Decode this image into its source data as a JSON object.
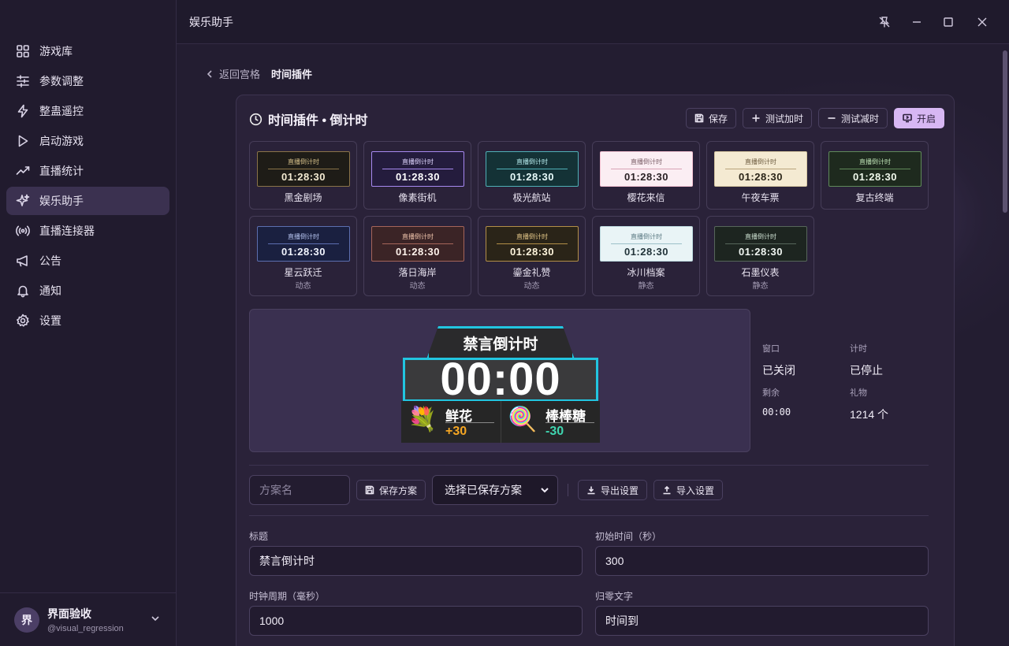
{
  "app": {
    "title": "娱乐助手"
  },
  "sidebar": {
    "items": [
      {
        "label": "游戏库",
        "icon": "grid-icon"
      },
      {
        "label": "参数调整",
        "icon": "sliders-icon"
      },
      {
        "label": "整蛊遥控",
        "icon": "lightning-icon"
      },
      {
        "label": "启动游戏",
        "icon": "play-icon"
      },
      {
        "label": "直播统计",
        "icon": "trend-icon"
      },
      {
        "label": "娱乐助手",
        "icon": "sparkle-icon",
        "active": true
      },
      {
        "label": "直播连接器",
        "icon": "broadcast-icon"
      },
      {
        "label": "公告",
        "icon": "megaphone-icon"
      },
      {
        "label": "通知",
        "icon": "bell-icon"
      },
      {
        "label": "设置",
        "icon": "gear-icon"
      }
    ],
    "user": {
      "avatar": "界",
      "name": "界面验收",
      "handle": "@visual_regression"
    }
  },
  "breadcrumb": {
    "back": "返回宫格",
    "current": "时间插件"
  },
  "card": {
    "title": "时间插件 • 倒计时",
    "buttons": {
      "save": "保存",
      "test_add": "测试加时",
      "test_sub": "测试减时",
      "open": "开启"
    }
  },
  "themes": [
    {
      "name": "黑金剧场",
      "sub": "",
      "preview_title": "直播倒计时",
      "preview_time": "01:28:30"
    },
    {
      "name": "像素街机",
      "sub": "",
      "preview_title": "直播倒计时",
      "preview_time": "01:28:30"
    },
    {
      "name": "极光航站",
      "sub": "",
      "preview_title": "直播倒计时",
      "preview_time": "01:28:30"
    },
    {
      "name": "樱花来信",
      "sub": "",
      "preview_title": "直播倒计时",
      "preview_time": "01:28:30"
    },
    {
      "name": "午夜车票",
      "sub": "",
      "preview_title": "直播倒计时",
      "preview_time": "01:28:30"
    },
    {
      "name": "复古终端",
      "sub": "",
      "preview_title": "直播倒计时",
      "preview_time": "01:28:30"
    },
    {
      "name": "星云跃迁",
      "sub": "动态",
      "preview_title": "直播倒计时",
      "preview_time": "01:28:30"
    },
    {
      "name": "落日海岸",
      "sub": "动态",
      "preview_title": "直播倒计时",
      "preview_time": "01:28:30"
    },
    {
      "name": "鎏金礼赞",
      "sub": "动态",
      "preview_title": "直播倒计时",
      "preview_time": "01:28:30"
    },
    {
      "name": "冰川档案",
      "sub": "静态",
      "preview_title": "直播倒计时",
      "preview_time": "01:28:30"
    },
    {
      "name": "石墨仪表",
      "sub": "静态",
      "preview_title": "直播倒计时",
      "preview_time": "01:28:30"
    }
  ],
  "widget": {
    "title": "禁言倒计时",
    "time": "00:00",
    "gifts": [
      {
        "name": "鲜花",
        "delta": "+30",
        "icon": "💐"
      },
      {
        "name": "棒棒糖",
        "delta": "-30",
        "icon": "🍭"
      }
    ]
  },
  "stats": {
    "window_label": "窗口",
    "window_value": "已关闭",
    "timer_label": "计时",
    "timer_value": "已停止",
    "remain_label": "剩余",
    "remain_value": "00:00",
    "gift_label": "礼物",
    "gift_value": "1214 个"
  },
  "presets": {
    "name_placeholder": "方案名",
    "save": "保存方案",
    "select": "选择已保存方案",
    "export": "导出设置",
    "import": "导入设置"
  },
  "form": {
    "title_label": "标题",
    "title_value": "禁言倒计时",
    "initial_label": "初始时间（秒）",
    "initial_value": "300",
    "period_label": "时钟周期（毫秒）",
    "period_value": "1000",
    "zero_label": "归零文字",
    "zero_value": "时间到"
  },
  "colors": {
    "accent": "#d7b7f3",
    "widget_border": "#22c5e0",
    "gift_plus": "#f5a623",
    "gift_minus": "#3fd6b0"
  }
}
